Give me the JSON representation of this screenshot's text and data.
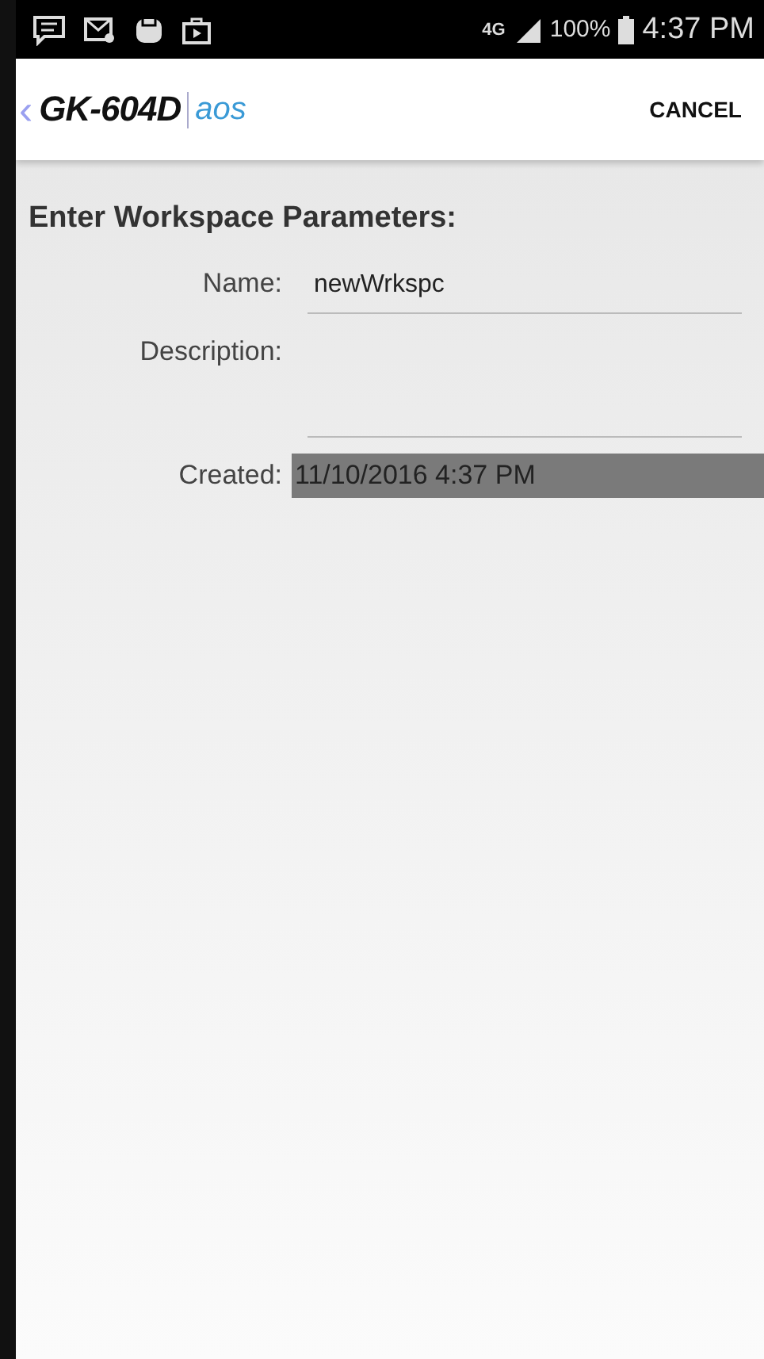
{
  "status_bar": {
    "network": "4G",
    "battery": "100%",
    "time": "4:37 PM"
  },
  "app_bar": {
    "back": "‹",
    "logo": "GK-604D",
    "logo_suffix": "aos",
    "action": "CANCEL"
  },
  "form": {
    "heading": "Enter Workspace Parameters:",
    "fields": [
      {
        "kind": "text",
        "label": "Name:",
        "value": "newWrkspc"
      },
      {
        "kind": "multiline",
        "label": "Description:"
      },
      {
        "kind": "readonly",
        "label": "Created:",
        "value": "11/10/2016 4:37 PM"
      }
    ]
  }
}
